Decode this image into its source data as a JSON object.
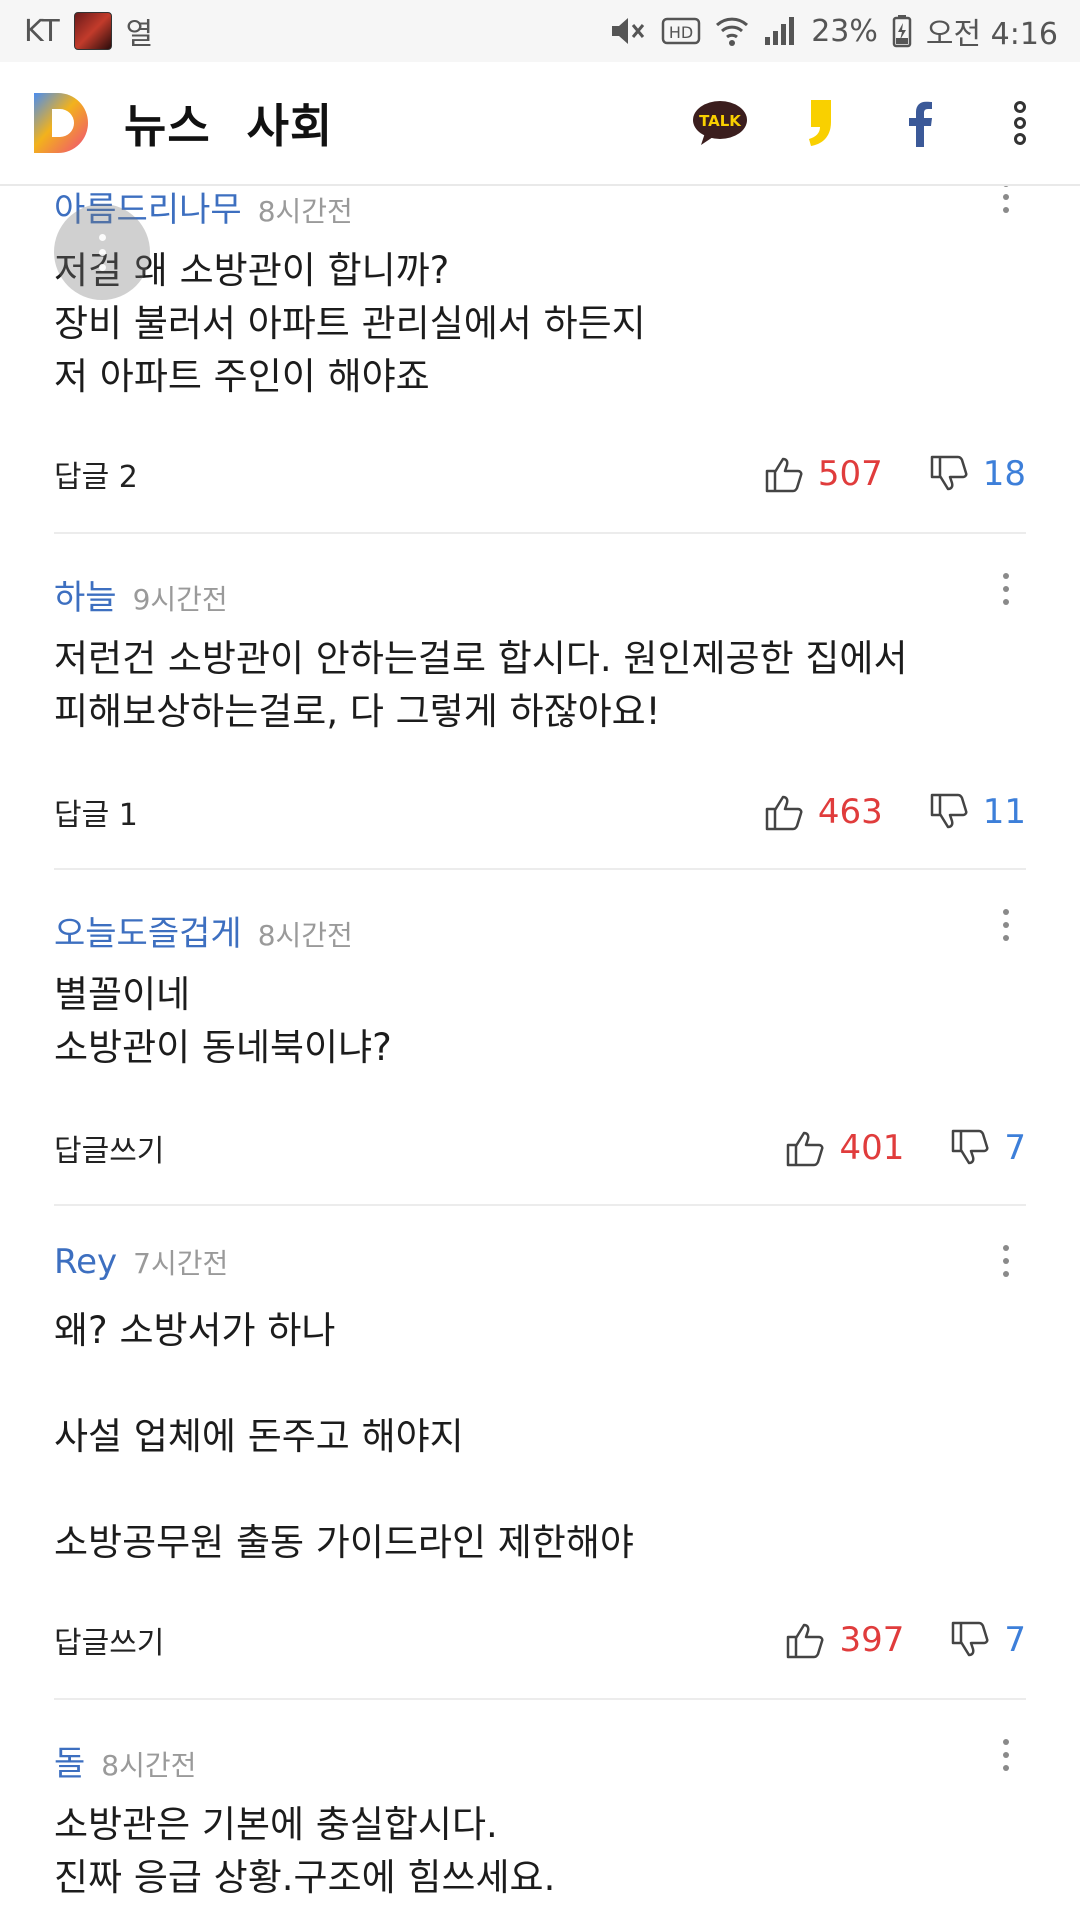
{
  "status_bar": {
    "carrier": "KT",
    "notification_text": "열",
    "battery": "23%",
    "time": "오전 4:16",
    "hd_label": "HD"
  },
  "app_bar": {
    "section_primary": "뉴스",
    "section_secondary": "사회",
    "talk_label": "TALK",
    "logo_icon": "daum-logo-icon",
    "share_icons": [
      "kakaotalk-icon",
      "kakaostory-icon",
      "facebook-icon",
      "more-vert-icon"
    ]
  },
  "comments": [
    {
      "author": "아름드리나무",
      "time": "8시간전",
      "body": "저걸 왜 소방관이 합니까?\n장비 불러서 아파트 관리실에서 하든지\n저 아파트 주인이 해야죠",
      "reply": "답글 2",
      "likes": "507",
      "dislikes": "18"
    },
    {
      "author": "하늘",
      "time": "9시간전",
      "body": "저런건 소방관이 안하는걸로 합시다. 원인제공한 집에서\n피해보상하는걸로, 다 그렇게 하잖아요!",
      "reply": "답글 1",
      "likes": "463",
      "dislikes": "11"
    },
    {
      "author": "오늘도즐겁게",
      "time": "8시간전",
      "body": "별꼴이네\n소방관이 동네북이냐?",
      "reply": "답글쓰기",
      "likes": "401",
      "dislikes": "7"
    },
    {
      "author": "Rey",
      "time": "7시간전",
      "body": "왜? 소방서가 하나\n\n사설 업체에 돈주고 해야지\n\n소방공무원 출동 가이드라인 제한해야",
      "reply": "답글쓰기",
      "likes": "397",
      "dislikes": "7"
    },
    {
      "author": "돌",
      "time": "8시간전",
      "body": "소방관은 기본에 충실합시다.\n진짜 응급 상황.구조에 힘쓰세요.",
      "reply": "",
      "likes": "",
      "dislikes": ""
    }
  ],
  "colors": {
    "author": "#3d6fc0",
    "like": "#e03c3c",
    "dislike": "#3d7fd9",
    "kakao_yellow": "#f9d000",
    "facebook_blue": "#3b5998"
  }
}
